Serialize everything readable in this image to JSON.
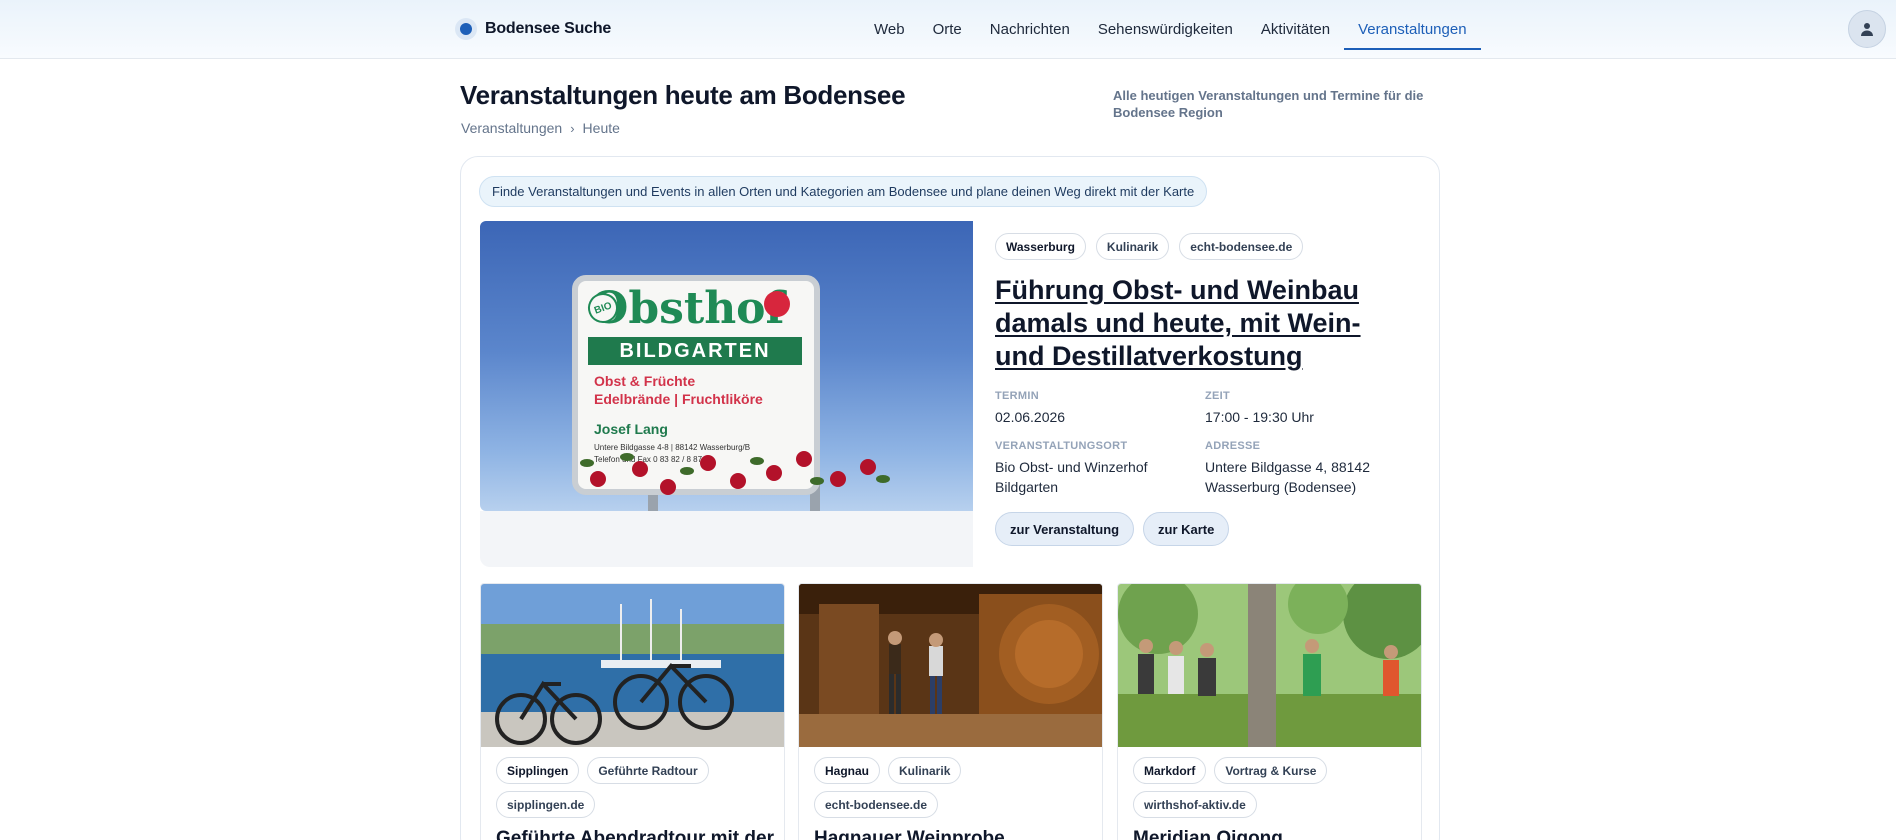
{
  "brand": {
    "name": "Bodensee Suche"
  },
  "nav": {
    "items": [
      {
        "label": "Web"
      },
      {
        "label": "Orte"
      },
      {
        "label": "Nachrichten"
      },
      {
        "label": "Sehenswürdigkeiten"
      },
      {
        "label": "Aktivitäten"
      },
      {
        "label": "Veranstaltungen",
        "active": true
      }
    ]
  },
  "page": {
    "title": "Veranstaltungen heute am Bodensee",
    "breadcrumb": [
      "Veranstaltungen",
      "Heute"
    ],
    "description": "Alle heutigen Veranstaltungen und Termine für die Bodensee Region",
    "info": "Finde Veranstaltungen und Events in allen Orten und Kategorien am Bodensee und plane deinen Weg direkt mit der Karte"
  },
  "featured": {
    "tags": [
      "Wasserburg",
      "Kulinarik",
      "echt-bodensee.de"
    ],
    "title": "Führung Obst- und Weinbau damals und heute, mit Wein- und Destillatverkostung",
    "termin_label": "TERMIN",
    "termin": "02.06.2026",
    "zeit_label": "ZEIT",
    "zeit": "17:00 - 19:30 Uhr",
    "ort_label": "VERANSTALTUNGSORT",
    "ort": "Bio Obst- und Winzerhof Bildgarten",
    "adresse_label": "ADRESSE",
    "adresse": "Untere Bildgasse 4, 88142 Wasserburg (Bodensee)",
    "btn_event": "zur Veranstaltung",
    "btn_map": "zur Karte",
    "image_sign": {
      "word": "Obsthof",
      "bio": "BIO",
      "band": "BILDGARTEN",
      "line1": "Obst & Früchte",
      "line2": "Edelbrände | Fruchtliköre",
      "owner": "Josef Lang",
      "small1": "Untere Bildgasse 4-8 | 88142 Wasserburg/B",
      "small2": "Telefon und Fax 0 83 82 / 8 87 49"
    }
  },
  "cards": [
    {
      "place": "Sipplingen",
      "category": "Geführte Radtour",
      "source": "sipplingen.de",
      "title": "Geführte Abendradtour mit der"
    },
    {
      "place": "Hagnau",
      "category": "Kulinarik",
      "source": "echt-bodensee.de",
      "title": "Hagnauer Weinprobe"
    },
    {
      "place": "Markdorf",
      "category": "Vortrag & Kurse",
      "source": "wirthshof-aktiv.de",
      "title": "Meridian Qigong"
    }
  ]
}
